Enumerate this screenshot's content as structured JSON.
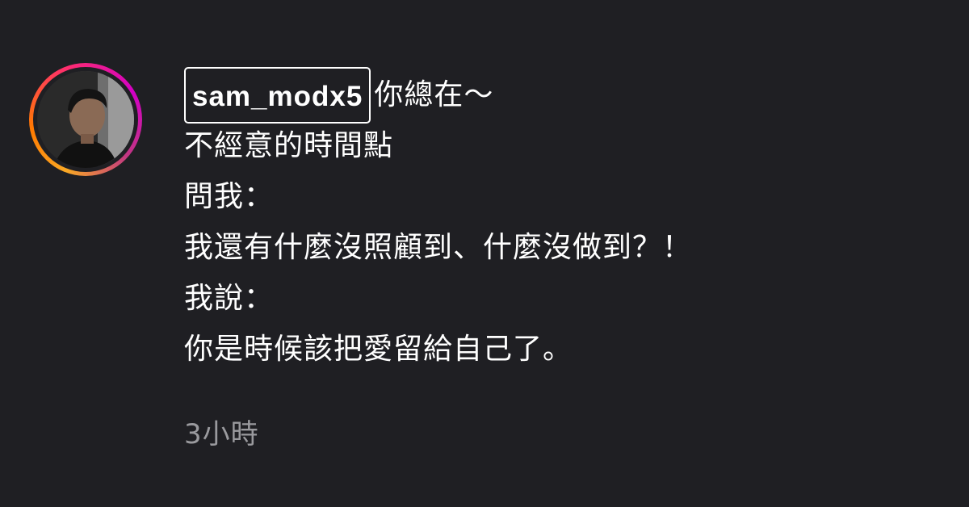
{
  "comment": {
    "author": "sam_modx5",
    "first_line_text": "你總在～",
    "lines": [
      "不經意的時間點",
      "問我：",
      "我還有什麼沒照顧到、什麼沒做到？！",
      "我說：",
      "你是時候該把愛留給自己了。"
    ],
    "timestamp": "3小時"
  },
  "colors": {
    "background": "#1f1f23",
    "text": "#ffffff",
    "timestamp": "#9a9a9e"
  }
}
